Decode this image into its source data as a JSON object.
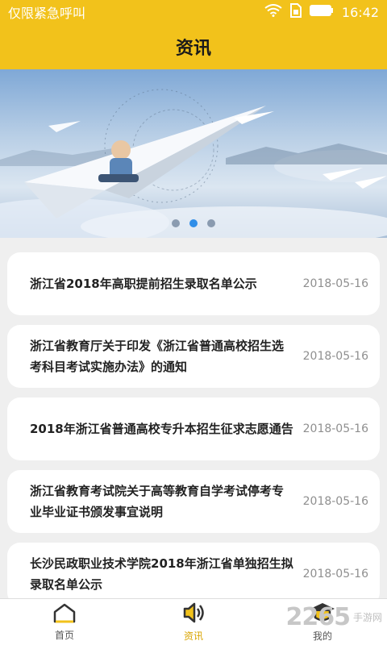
{
  "status": {
    "carrier": "仅限紧急呼叫",
    "time": "16:42"
  },
  "header": {
    "title": "资讯"
  },
  "banner": {
    "slide_count": 3,
    "active_index": 1
  },
  "news": [
    {
      "title": "浙江省2018年高职提前招生录取名单公示",
      "date": "2018-05-16"
    },
    {
      "title": "浙江省教育厅关于印发《浙江省普通高校招生选考科目考试实施办法》的通知",
      "date": "2018-05-16"
    },
    {
      "title": "2018年浙江省普通高校专升本招生征求志愿通告",
      "date": "2018-05-16"
    },
    {
      "title": "浙江省教育考试院关于高等教育自学考试停考专业毕业证书颁发事宜说明",
      "date": "2018-05-16"
    },
    {
      "title": "长沙民政职业技术学院2018年浙江省单独招生拟录取名单公示",
      "date": "2018-05-16"
    }
  ],
  "tabs": [
    {
      "label": "首页",
      "icon": "home-icon"
    },
    {
      "label": "资讯",
      "icon": "speaker-icon"
    },
    {
      "label": "我的",
      "icon": "graduation-cap-icon"
    }
  ],
  "watermark": {
    "logo": "2265",
    "sub": "手游网"
  },
  "colors": {
    "brand": "#f2c21b",
    "active_dot": "#2f8ee8",
    "active_tab": "#d9a400"
  }
}
